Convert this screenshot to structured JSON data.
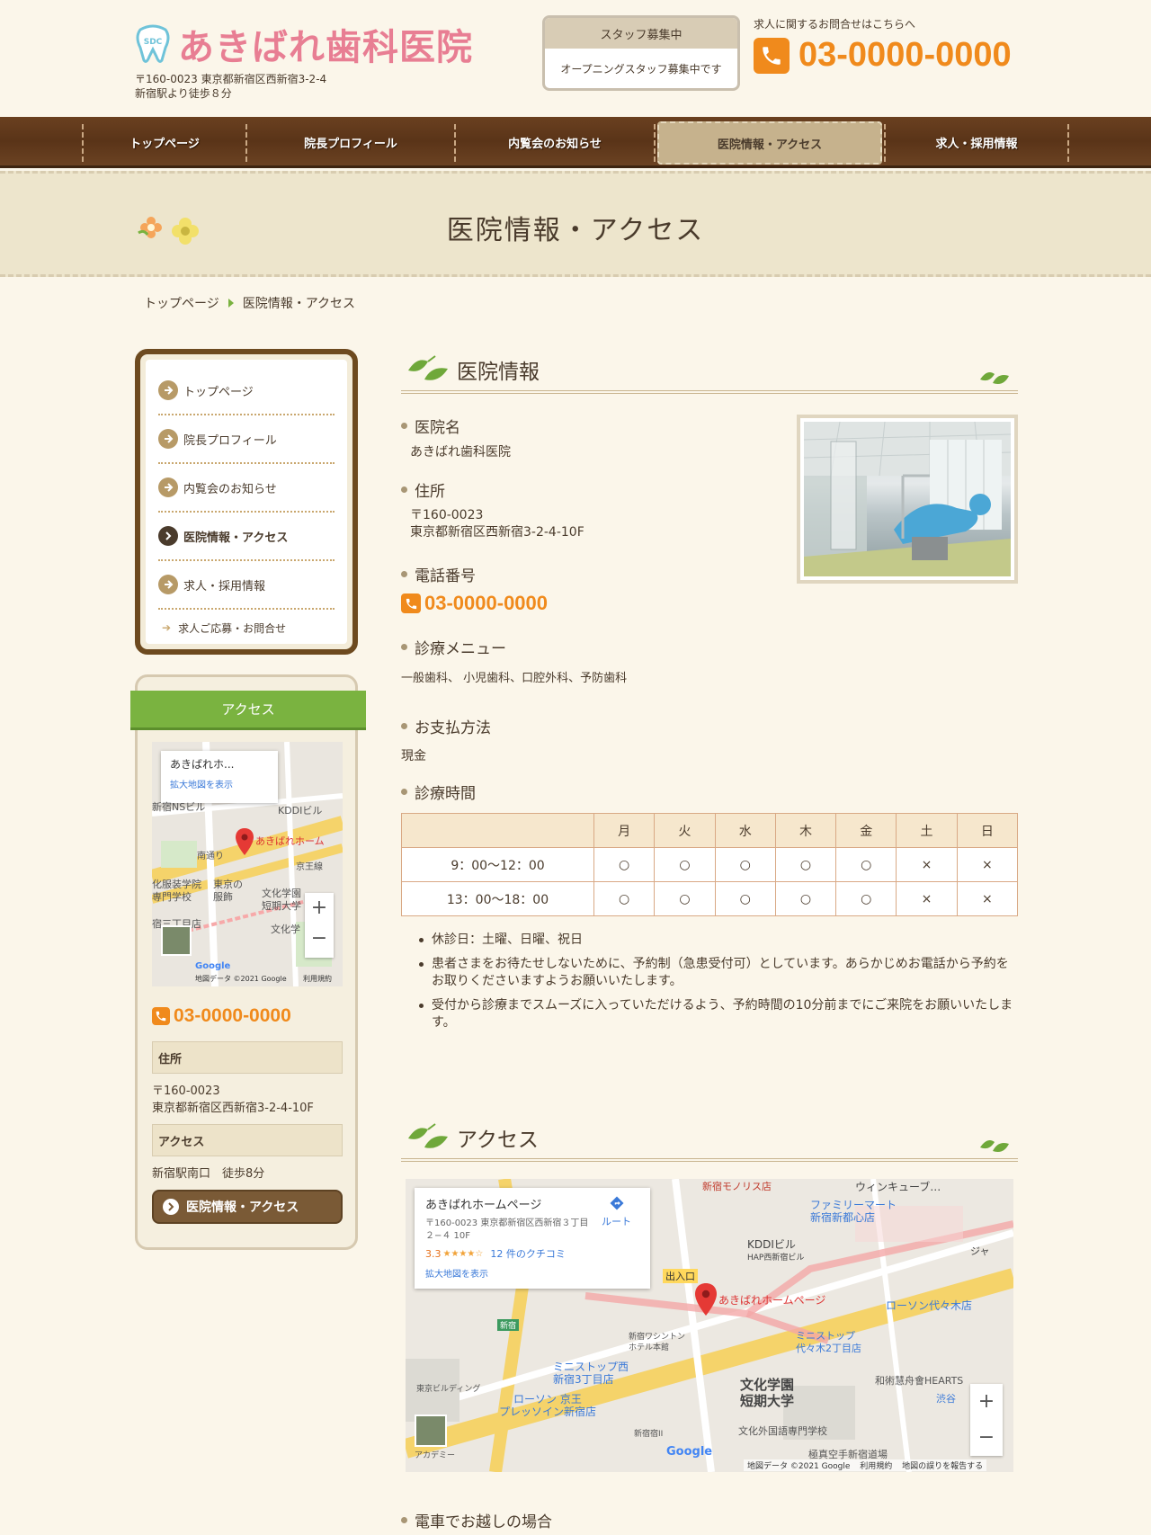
{
  "header": {
    "logo_abbr": "SDC",
    "logo_text": "あきばれ歯科医院",
    "address_line1": "〒160-0023 東京都新宿区西新宿3-2-4",
    "address_line2": "新宿駅より徒歩８分",
    "staff_box": {
      "title": "スタッフ募集中",
      "text": "オープニングスタッフ募集中です"
    },
    "contact_label": "求人に関するお問合せはこちらへ",
    "phone": "03-0000-0000"
  },
  "nav": {
    "items": [
      {
        "label": "トップページ"
      },
      {
        "label": "院長プロフィール"
      },
      {
        "label": "内覧会のお知らせ"
      },
      {
        "label": "医院情報・アクセス",
        "active": true
      },
      {
        "label": "求人・採用情報"
      }
    ]
  },
  "page_title": "医院情報・アクセス",
  "breadcrumb": {
    "home": "トップページ",
    "current": "医院情報・アクセス"
  },
  "sidenav": {
    "items": [
      {
        "label": "トップページ"
      },
      {
        "label": "院長プロフィール"
      },
      {
        "label": "内覧会のお知らせ"
      },
      {
        "label": "医院情報・アクセス",
        "active": true
      },
      {
        "label": "求人・採用情報"
      }
    ],
    "sub_label": "求人ご応募・お問合せ"
  },
  "access_box": {
    "title": "アクセス",
    "map_card_name": "あきばれホ...",
    "map_card_link": "拡大地図を表示",
    "map_labels": [
      "新宿NSビル",
      "KDDIビル",
      "南通り",
      "京王線",
      "あきばれホーム",
      "化服装学院",
      "東京の",
      "専門学校",
      "服飾",
      "文化学園",
      "短期大学",
      "文化学",
      "宿三丁目店"
    ],
    "map_credit": "地図データ ©2021 Google",
    "map_terms": "利用規約",
    "phone": "03-0000-0000",
    "address_label": "住所",
    "postal": "〒160-0023",
    "address": "東京都新宿区西新宿3-2-4-10F",
    "access_label": "アクセス",
    "access_text": "新宿駅南口　徒歩8分",
    "button": "医院情報・アクセス"
  },
  "clinic_info": {
    "section_title": "医院情報",
    "name_label": "医院名",
    "name_value": "あきばれ歯科医院",
    "address_label": "住所",
    "postal": "〒160-0023",
    "address": "東京都新宿区西新宿3-2-4-10F",
    "phone_label": "電話番号",
    "phone": "03-0000-0000",
    "menu_label": "診療メニュー",
    "menu_value": "一般歯科、 小児歯科、口腔外科、予防歯科",
    "payment_label": "お支払方法",
    "payment_value": "現金",
    "hours_label": "診療時間"
  },
  "schedule": {
    "days": [
      "月",
      "火",
      "水",
      "木",
      "金",
      "土",
      "日"
    ],
    "rows": [
      {
        "time": "9：00〜12：00",
        "marks": [
          "○",
          "○",
          "○",
          "○",
          "○",
          "×",
          "×"
        ]
      },
      {
        "time": "13：00〜18：00",
        "marks": [
          "○",
          "○",
          "○",
          "○",
          "○",
          "×",
          "×"
        ]
      }
    ]
  },
  "notes": [
    "休診日：土曜、日曜、祝日",
    "患者さまをお待たせしないために、予約制（急患受付可）としています。あらかじめお電話から予約をお取りくださいますようお願いいたします。",
    "受付から診療までスムーズに入っていただけるよう、予約時間の10分前までにご来院をお願いいたします。"
  ],
  "access_section": {
    "title": "アクセス",
    "map_card": {
      "name": "あきばれホームページ",
      "address": "〒160-0023 東京都新宿区西新宿３丁目２−４ 10F",
      "route": "ルート",
      "rating": "3.3",
      "stars": 3.3,
      "reviews": "12 件のクチコミ",
      "link": "拡大地図を表示"
    },
    "map_labels": [
      "新宿モノリス店",
      "ウィンキューブ…",
      "ファミリーマート",
      "新宿新都心店",
      "KDDIビル",
      "HAP西新宿ビル",
      "出入口",
      "あきばれホームページ",
      "ローソン代々木店",
      "新宿ワシントン",
      "ホテル本館",
      "ミニストップ西",
      "新宿3丁目店",
      "ミニストップ",
      "代々木2丁目店",
      "文化学園",
      "短期大学",
      "和術慧舟會HEARTS",
      "ローソン 京王",
      "プレッソイン新宿店",
      "文化外国語専門学校",
      "極真空手新宿道場",
      "渋谷",
      "東京ビルディング",
      "新宿",
      "ジャ",
      "新宿宿II",
      "アカデミー"
    ],
    "map_credit": "地図データ ©2021 Google",
    "map_terms": "利用規約",
    "map_report": "地図の誤りを報告する"
  },
  "train_label": "電車でお越しの場合",
  "colors": {
    "accent": "#f08a1c",
    "brand_pink": "#e87e93",
    "nav_brown": "#5a3418",
    "green": "#7ab340"
  },
  "icons": [
    "tooth-logo-icon",
    "phone-icon",
    "leaf-icon",
    "flower-icon",
    "arrow-circle-icon",
    "map-pin-icon",
    "route-icon"
  ]
}
